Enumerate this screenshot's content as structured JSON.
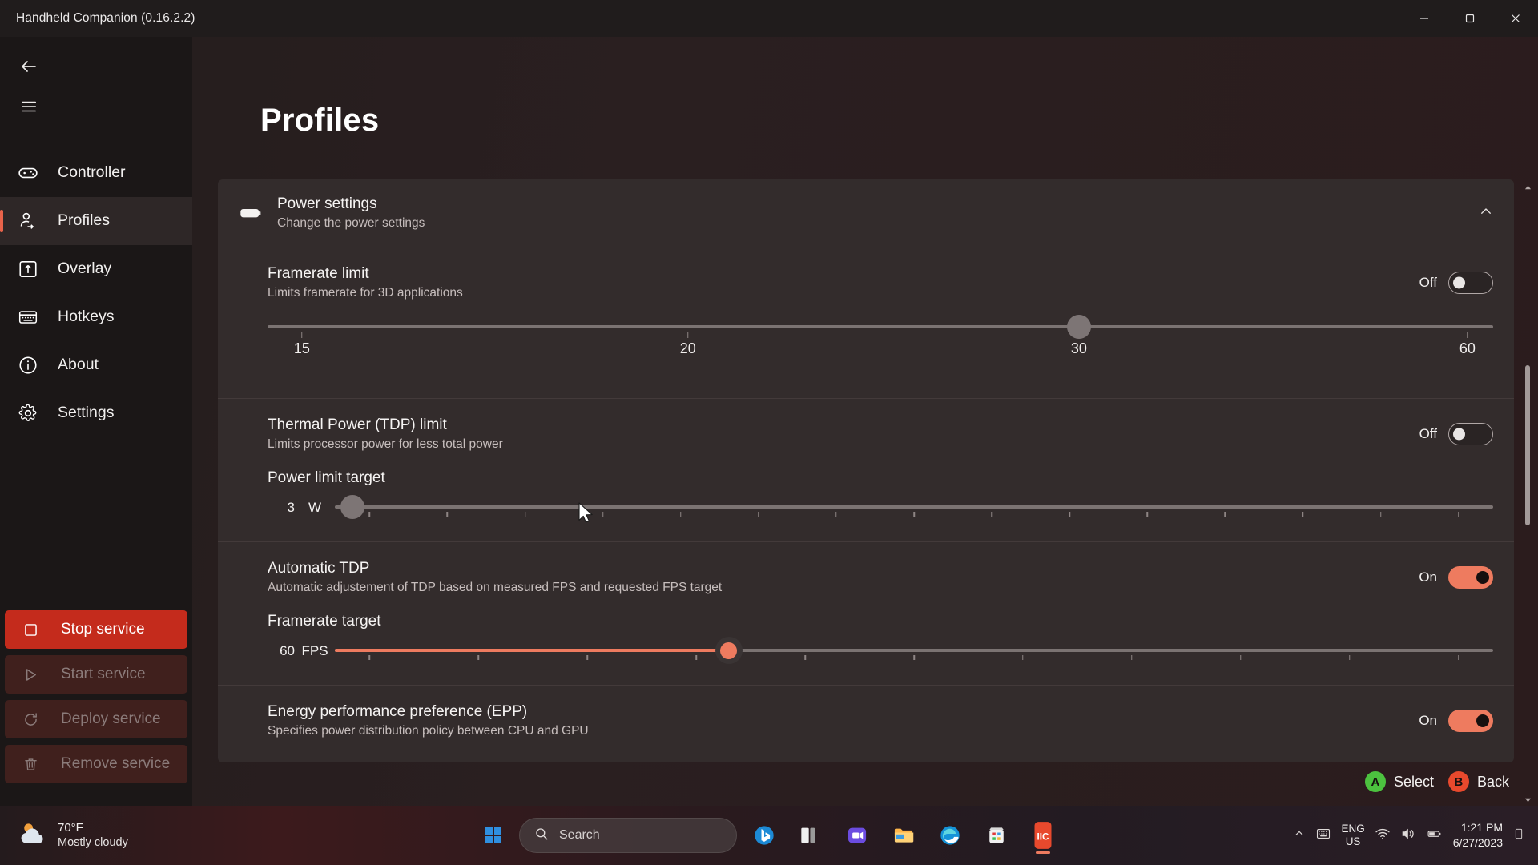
{
  "window": {
    "title": "Handheld Companion (0.16.2.2)",
    "minimize_label": "Minimize",
    "maximize_label": "Restore",
    "close_label": "Close"
  },
  "sidebar": {
    "back_label": "Back",
    "menu_label": "Navigation menu",
    "items": [
      {
        "label": "Controller",
        "icon": "gamepad-icon",
        "selected": false
      },
      {
        "label": "Profiles",
        "icon": "person-settings-icon",
        "selected": true
      },
      {
        "label": "Overlay",
        "icon": "overlay-icon",
        "selected": false
      },
      {
        "label": "Hotkeys",
        "icon": "keyboard-icon",
        "selected": false
      },
      {
        "label": "About",
        "icon": "info-icon",
        "selected": false
      },
      {
        "label": "Settings",
        "icon": "gear-icon",
        "selected": false
      }
    ],
    "service_buttons": [
      {
        "label": "Stop service",
        "icon": "stop-icon",
        "state": "enabled"
      },
      {
        "label": "Start service",
        "icon": "play-icon",
        "state": "disabled"
      },
      {
        "label": "Deploy service",
        "icon": "refresh-icon",
        "state": "disabled"
      },
      {
        "label": "Remove service",
        "icon": "trash-icon",
        "state": "disabled"
      }
    ]
  },
  "main": {
    "page_title": "Profiles",
    "power_card": {
      "title": "Power settings",
      "subtitle": "Change the power settings",
      "icon": "battery-icon",
      "expanded": true,
      "chevron": "chevron-up-icon"
    },
    "framerate_limit": {
      "title": "Framerate limit",
      "subtitle": "Limits framerate for 3D applications",
      "toggle_state": "Off",
      "toggle_on": false,
      "slider": {
        "value": 30,
        "thumb_percent": 66.2,
        "tick_labels": [
          "15",
          "20",
          "30",
          "60"
        ],
        "tick_percents": [
          2.8,
          34.3,
          66.2,
          97.9
        ]
      }
    },
    "tdp_limit": {
      "title": "Thermal Power (TDP) limit",
      "subtitle": "Limits processor power for less total power",
      "toggle_state": "Off",
      "toggle_on": false,
      "slider_label": "Power limit target",
      "slider_value": "3",
      "slider_unit": "W",
      "slider_percent": 1.5,
      "slider_tick_count": 15
    },
    "automatic_tdp": {
      "title": "Automatic TDP",
      "subtitle": "Automatic adjustement of TDP based on measured FPS and requested FPS target",
      "toggle_state": "On",
      "toggle_on": true,
      "slider_label": "Framerate target",
      "slider_value": "60",
      "slider_unit": "FPS",
      "slider_percent": 34.0,
      "slider_tick_count": 11
    },
    "epp": {
      "title": "Energy performance preference (EPP)",
      "subtitle": "Specifies power distribution policy between CPU and GPU",
      "toggle_state": "On",
      "toggle_on": true
    },
    "scrollbar": {
      "up_arrow": "chevron-up-icon",
      "down_arrow": "chevron-down-icon"
    }
  },
  "hints": [
    {
      "button": "A",
      "label": "Select",
      "color": "#4cc23f"
    },
    {
      "button": "B",
      "label": "Back",
      "color": "#e8492d"
    }
  ],
  "taskbar": {
    "weather": {
      "temperature": "70°F",
      "condition": "Mostly cloudy",
      "icon": "partly-cloudy-icon"
    },
    "start_label": "Start",
    "search": {
      "placeholder": "Search",
      "icon": "search-icon"
    },
    "apps": [
      {
        "name": "bing-chat-icon",
        "active": false
      },
      {
        "name": "task-view-icon",
        "active": false
      },
      {
        "name": "teams-icon",
        "active": false
      },
      {
        "name": "file-explorer-icon",
        "active": false
      },
      {
        "name": "edge-icon",
        "active": false
      },
      {
        "name": "store-icon",
        "active": false
      },
      {
        "name": "handheld-companion-icon",
        "active": true
      }
    ],
    "tray": {
      "overflow": "chevron-up-icon",
      "keyboard": "touch-keyboard-icon",
      "language_line1": "ENG",
      "language_line2": "US",
      "wifi": "wifi-icon",
      "volume": "volume-icon",
      "battery": "battery-icon",
      "time": "1:21 PM",
      "date": "6/27/2023",
      "notifications": "notification-icon"
    }
  },
  "colors": {
    "accent": "#ee7b5f",
    "danger": "#c42b1c",
    "card": "#332c2c",
    "sidebar": "#1b1717"
  }
}
